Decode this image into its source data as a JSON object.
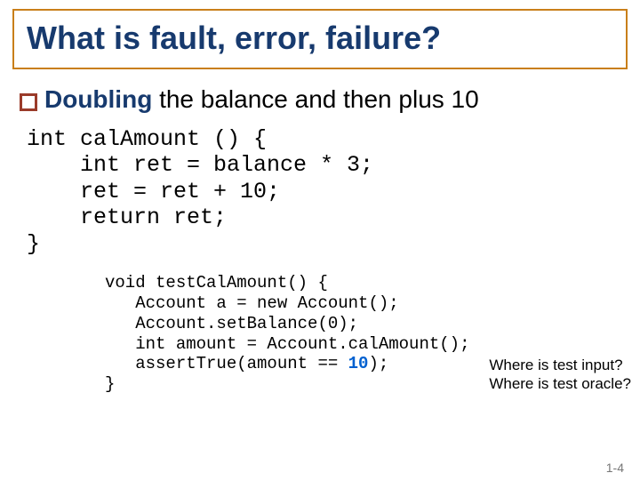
{
  "title": "What is fault, error, failure?",
  "bullet": {
    "lead": "Doubling",
    "rest": " the balance and then plus 10"
  },
  "code1": {
    "l1": "int calAmount () {",
    "l2": "    int ret = balance * 3;",
    "l3": "    ret = ret + 10;",
    "l4": "    return ret;",
    "l5": "}"
  },
  "code2": {
    "l1": "void testCalAmount() {",
    "l2": "   Account a = new Account();",
    "l3": "   Account.setBalance(0);",
    "l4": "   int amount = Account.calAmount();",
    "l5a": "   assertTrue(amount == ",
    "l5num": "10",
    "l5b": ");",
    "l6": "}"
  },
  "annot": {
    "l1": "Where is test input?",
    "l2": "Where is test oracle?"
  },
  "pagenum": "1-4"
}
